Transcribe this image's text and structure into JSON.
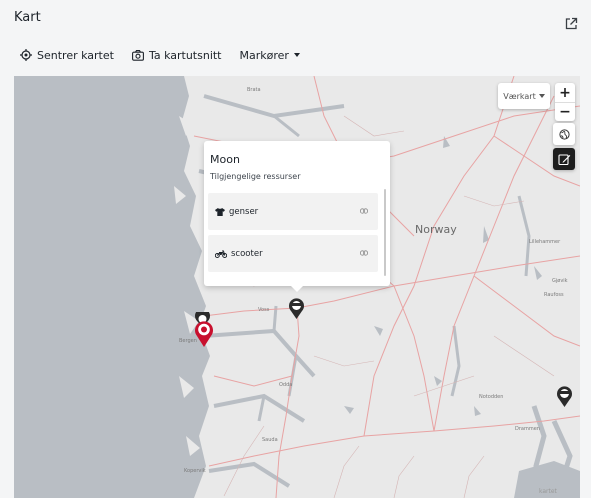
{
  "header": {
    "title": "Kart"
  },
  "toolbar": {
    "center_label": "Sentrer kartet",
    "snapshot_label": "Ta kartutsnitt",
    "markers_label": "Markører"
  },
  "map": {
    "layer_select": "Værkart",
    "zoom_in": "+",
    "zoom_out": "−",
    "places": {
      "norway": "Norway",
      "brata": "Brata",
      "voss": "Voss",
      "odda": "Odda",
      "sauda": "Sauda",
      "drammen": "Drammen",
      "lillehammer": "Lillehammer",
      "raufoss": "Raufoss",
      "gjovik": "Gjøvik",
      "bergen": "Bergen",
      "kopervik": "Kopervik",
      "notodden": "Notodden"
    },
    "attribution": "kartet",
    "colors": {
      "land": "#e9e9e9",
      "water": "#b9bec4",
      "roads": "#e8a3a3",
      "selected_marker": "#c8102e",
      "marker": "#2b2b2b"
    }
  },
  "popup": {
    "title": "Moon",
    "subtitle": "Tilgjengelige ressurser",
    "resources": [
      {
        "label": "genser",
        "icon": "shirt-icon"
      },
      {
        "label": "scooter",
        "icon": "motorcycle-icon"
      }
    ]
  }
}
